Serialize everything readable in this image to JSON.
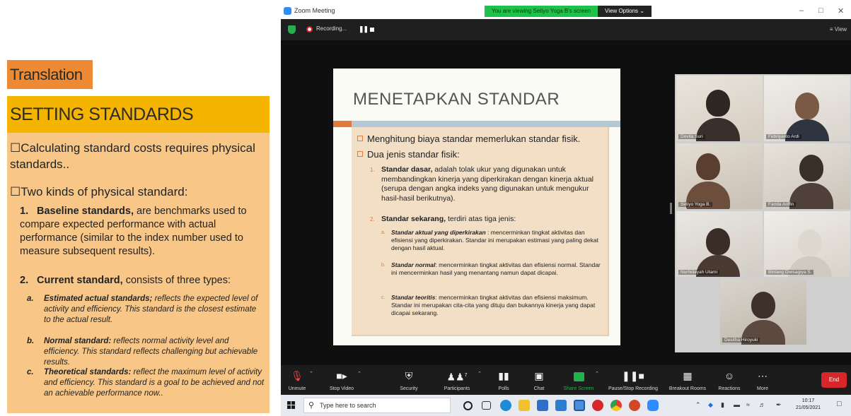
{
  "translation": {
    "tag": "Translation",
    "header": "SETTING STANDARDS",
    "bullet1": "☐Calculating standard costs requires physical standards..",
    "bullet2": "☐Two kinds of physical standard:",
    "item1_num": "1.",
    "item1_bold": "Baseline standards,",
    "item1_text": " are benchmarks used to compare expected performance with actual performance (similar to the index number used to measure subsequent results).",
    "item2_num": "2.",
    "item2_bold": "Current standard,",
    "item2_text": " consists of three types:",
    "subs": [
      {
        "letter": "a.",
        "bold": "Estimated actual standards;",
        "text": " reflects the expected level of activity and efficiency. This standard is the closest estimate to the actual result."
      },
      {
        "letter": "b.",
        "bold": "Normal standard:",
        "text": " reflects normal activity level and efficiency. This standard reflects challenging but achievable results."
      },
      {
        "letter": "c.",
        "bold": "Theoretical standards:",
        "text": " reflect the maximum level of activity and efficiency. This standard is a goal to be achieved and not an achievable performance now.."
      }
    ]
  },
  "zoom": {
    "window_title": "Zoom Meeting",
    "viewing_banner": "You are viewing Setiyo Yoga B's screen",
    "view_options": "View Options ⌄",
    "recording_label": "Recording...",
    "view_label": "≡ View",
    "minimize": "–",
    "maximize": "□",
    "close": "✕"
  },
  "slide": {
    "title": "MENETAPKAN STANDAR",
    "bullet1": "Menghitung biaya standar memerlukan standar fisik.",
    "bullet2": "Dua jenis standar fisik:",
    "n1": "1.",
    "n1_bold": "Standar dasar,",
    "n1_text": " adalah tolak ukur yang digunakan untuk membandingkan kinerja yang diperkirakan dengan kinerja aktual (serupa dengan angka indeks yang digunakan untuk mengukur hasil-hasil berikutnya).",
    "n2": "2.",
    "n2_bold": "Standar sekarang,",
    "n2_text": " terdiri atas tiga jenis:",
    "subs": [
      {
        "letter": "a.",
        "bold": "Standar aktual yang diperkirakan",
        "text": " : mencerminkan tingkat aktivitas dan efisiensi yang diperkirakan. Standar ini merupakan estimasi yang paling dekat dengan hasil aktual."
      },
      {
        "letter": "b.",
        "bold": "Standar normal",
        "text": ": mencerminkan tingkat aktivitas dan efisiensi normal. Standar ini mencerminkan hasil yang menantang namun dapat dicapai."
      },
      {
        "letter": "c.",
        "bold": "Standar teoritis",
        "text": ": mencerminkan tingkat aktivitas dan efisiensi maksimum. Standar ini merupakan cita-cita yang dituju dan bukannya kinerja yang dapat dicapai sekarang."
      }
    ]
  },
  "participants": [
    {
      "name": "Devita Suri"
    },
    {
      "name": "Febriyanto Ardi"
    },
    {
      "name": "Setiyo Yoga B."
    },
    {
      "name": "Farida Ariffin"
    },
    {
      "name": "Nurhidayah Utami"
    },
    {
      "name": "Bintang Dwisagiya S."
    },
    {
      "name": "Desitha Hiroyuki"
    }
  ],
  "toolbar": {
    "unmute": "Unmute",
    "stop_video": "Stop Video",
    "security": "Security",
    "participants": "Participants",
    "participants_count": "7",
    "polls": "Polls",
    "chat": "Chat",
    "share_screen": "Share Screen",
    "pause_stop_recording": "Pause/Stop Recording",
    "breakout_rooms": "Breakout Rooms",
    "reactions": "Reactions",
    "more": "More",
    "end": "End"
  },
  "taskbar": {
    "search_placeholder": "Type here to search",
    "time": "10:17",
    "date": "21/05/2021"
  }
}
